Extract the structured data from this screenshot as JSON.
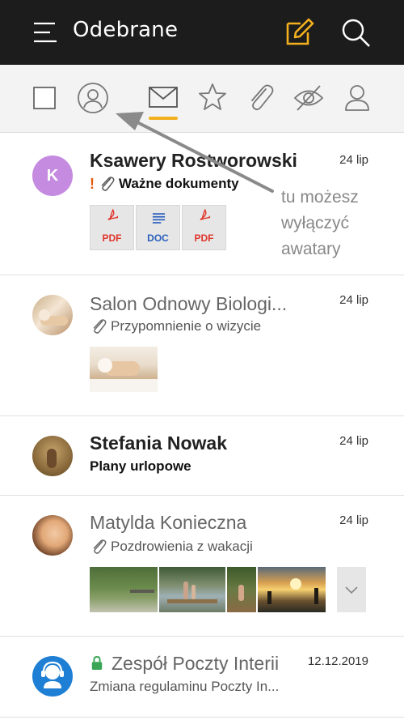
{
  "appbar": {
    "title": "Odebrane",
    "icons": [
      "menu-icon",
      "compose-icon",
      "search-icon"
    ],
    "accent": "#f2b01e"
  },
  "filters": {
    "items": [
      "select-all-checkbox",
      "avatar-toggle-icon",
      "envelope-icon",
      "star-icon",
      "paperclip-icon",
      "eye-off-icon",
      "person-icon"
    ],
    "active": "envelope-icon"
  },
  "annotation": {
    "line1": "tu możesz",
    "line2": "wyłączyć",
    "line3": "awatary"
  },
  "messages": [
    {
      "sender": "Ksawery Rostworowski",
      "avatar_letter": "K",
      "avatar_color": "#c58be0",
      "date": "24 lip",
      "important": "!",
      "subject": "Ważne dokumenty",
      "unread": true,
      "attachments": [
        {
          "type": "PDF"
        },
        {
          "type": "DOC"
        },
        {
          "type": "PDF"
        }
      ]
    },
    {
      "sender": "Salon Odnowy Biologi...",
      "date": "24 lip",
      "subject": "Przypomnienie o wizycie",
      "unread": false,
      "photos": 1
    },
    {
      "sender": "Stefania Nowak",
      "date": "24 lip",
      "subject": "Plany urlopowe",
      "unread": true
    },
    {
      "sender": "Matylda Konieczna",
      "date": "24 lip",
      "subject": "Pozdrowienia z wakacji",
      "unread": false,
      "photos": 4
    },
    {
      "sender": "Zespół Poczty Interii",
      "date": "12.12.2019",
      "subject": "Zmiana regulaminu Poczty In...",
      "unread": false,
      "verified_color": "#3aa655"
    }
  ]
}
